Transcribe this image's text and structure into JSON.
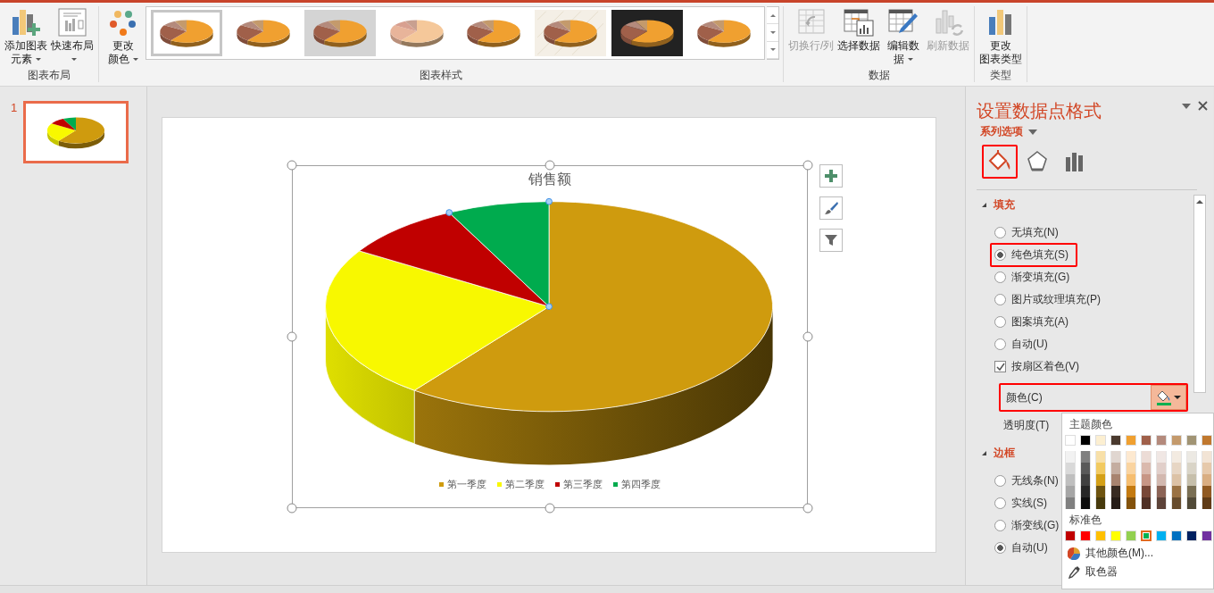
{
  "ribbon": {
    "groups": [
      {
        "label": "图表布局",
        "buttons": [
          {
            "kind": "add-element",
            "lines": [
              "添加图表",
              "元素"
            ],
            "dropdown": true,
            "disabled": false
          },
          {
            "kind": "layout",
            "lines": [
              "快速布局"
            ],
            "dropdown": true,
            "disabled": false
          }
        ]
      },
      {
        "label": "图表样式",
        "buttons": [
          {
            "kind": "colors",
            "lines": [
              "更改",
              "颜色"
            ],
            "dropdown": true,
            "disabled": false
          }
        ],
        "gallery": [
          {
            "selected": true
          },
          {
            "selected": false
          },
          {
            "selected": false
          },
          {
            "selected": false
          },
          {
            "selected": false
          },
          {
            "selected": false
          },
          {
            "selected": false
          },
          {
            "selected": false
          }
        ]
      },
      {
        "label": "数据",
        "buttons": [
          {
            "kind": "switch",
            "lines": [
              "切换行/列"
            ],
            "dropdown": false,
            "disabled": true
          },
          {
            "kind": "select-data",
            "lines": [
              "选择数据"
            ],
            "dropdown": false,
            "disabled": false
          },
          {
            "kind": "edit-data",
            "lines": [
              "编辑数",
              "据"
            ],
            "dropdown": true,
            "disabled": false
          },
          {
            "kind": "refresh",
            "lines": [
              "刷新数据"
            ],
            "dropdown": false,
            "disabled": true
          }
        ]
      },
      {
        "label": "类型",
        "buttons": [
          {
            "kind": "change-type",
            "lines": [
              "更改",
              "图表类型"
            ],
            "dropdown": false,
            "disabled": false
          }
        ]
      }
    ]
  },
  "slides": [
    {
      "number": "1",
      "selected": true
    }
  ],
  "chart": {
    "title": "销售额",
    "legend": [
      {
        "label": "第一季度",
        "color": "#cf9b0e"
      },
      {
        "label": "第二季度",
        "color": "#f8f800"
      },
      {
        "label": "第三季度",
        "color": "#c00000"
      },
      {
        "label": "第四季度",
        "color": "#00ab4e"
      }
    ]
  },
  "format_pane": {
    "title": "设置数据点格式",
    "options_menu": "系列选项",
    "tabs": [
      {
        "kind": "fill",
        "selected": true,
        "highlighted": true
      },
      {
        "kind": "effects",
        "selected": false,
        "highlighted": false
      },
      {
        "kind": "options",
        "selected": false,
        "highlighted": false
      }
    ],
    "sections": [
      {
        "heading": "填充",
        "expanded": true,
        "items": [
          {
            "kind": "radio",
            "label": "无填充(N)",
            "selected": false,
            "highlighted": false
          },
          {
            "kind": "radio",
            "label": "纯色填充(S)",
            "selected": true,
            "highlighted": true
          },
          {
            "kind": "radio",
            "label": "渐变填充(G)",
            "selected": false,
            "highlighted": false
          },
          {
            "kind": "radio",
            "label": "图片或纹理填充(P)",
            "selected": false,
            "highlighted": false
          },
          {
            "kind": "radio",
            "label": "图案填充(A)",
            "selected": false,
            "highlighted": false
          },
          {
            "kind": "radio",
            "label": "自动(U)",
            "selected": false,
            "highlighted": false
          },
          {
            "kind": "checkbox",
            "label": "按扇区着色(V)",
            "checked": true
          },
          {
            "kind": "color",
            "label": "颜色(C)",
            "color": "#00b050",
            "open": true,
            "highlighted": true
          },
          {
            "kind": "text",
            "label": "透明度(T)"
          }
        ]
      },
      {
        "heading": "边框",
        "expanded": true,
        "items": [
          {
            "kind": "radio",
            "label": "无线条(N)",
            "selected": false,
            "highlighted": false
          },
          {
            "kind": "radio",
            "label": "实线(S)",
            "selected": false,
            "highlighted": false
          },
          {
            "kind": "radio",
            "label": "渐变线(G)",
            "selected": false,
            "highlighted": false
          },
          {
            "kind": "radio",
            "label": "自动(U)",
            "selected": true,
            "highlighted": false
          }
        ]
      }
    ]
  },
  "color_picker": {
    "theme_label": "主题颜色",
    "theme_colors": [
      {
        "color": "#ffffff",
        "selected": false,
        "tints": [
          {
            "color": "#f2f2f2"
          },
          {
            "color": "#d9d9d9"
          },
          {
            "color": "#bfbfbf"
          },
          {
            "color": "#a6a6a6"
          },
          {
            "color": "#808080"
          }
        ]
      },
      {
        "color": "#000000",
        "selected": false,
        "tints": [
          {
            "color": "#7f7f7f"
          },
          {
            "color": "#595959"
          },
          {
            "color": "#404040"
          },
          {
            "color": "#262626"
          },
          {
            "color": "#0d0d0d"
          }
        ]
      },
      {
        "color": "#fcefd1",
        "selected": false,
        "tints": [
          {
            "color": "#f8e0a8"
          },
          {
            "color": "#f2ca60"
          },
          {
            "color": "#d4a017"
          },
          {
            "color": "#6e5410"
          },
          {
            "color": "#473a0c"
          }
        ]
      },
      {
        "color": "#4a3a2e",
        "selected": false,
        "tints": [
          {
            "color": "#e0d6d0"
          },
          {
            "color": "#c4ada0"
          },
          {
            "color": "#a88470"
          },
          {
            "color": "#382b22"
          },
          {
            "color": "#251c17"
          }
        ]
      },
      {
        "color": "#f0a030",
        "selected": false,
        "tints": [
          {
            "color": "#fde9d0"
          },
          {
            "color": "#fad4a0"
          },
          {
            "color": "#f6be70"
          },
          {
            "color": "#c47a10"
          },
          {
            "color": "#83520b"
          }
        ]
      },
      {
        "color": "#a0604a",
        "selected": false,
        "tints": [
          {
            "color": "#ecdcd6"
          },
          {
            "color": "#dab9ad"
          },
          {
            "color": "#c79685"
          },
          {
            "color": "#784837"
          },
          {
            "color": "#503025"
          }
        ]
      },
      {
        "color": "#b48a7c",
        "selected": false,
        "tints": [
          {
            "color": "#f0e7e4"
          },
          {
            "color": "#e1cfca"
          },
          {
            "color": "#d2b8af"
          },
          {
            "color": "#8c6456"
          },
          {
            "color": "#5d4339"
          }
        ]
      },
      {
        "color": "#c49a6c",
        "selected": false,
        "tints": [
          {
            "color": "#f3ebe1"
          },
          {
            "color": "#e7d6c4"
          },
          {
            "color": "#dcc2a6"
          },
          {
            "color": "#9a7244"
          },
          {
            "color": "#674c2d"
          }
        ]
      },
      {
        "color": "#a19474",
        "selected": false,
        "tints": [
          {
            "color": "#ece9e3"
          },
          {
            "color": "#d9d4c7"
          },
          {
            "color": "#c6bfab"
          },
          {
            "color": "#7a6f54"
          },
          {
            "color": "#514a38"
          }
        ]
      },
      {
        "color": "#c0782e",
        "selected": false,
        "tints": [
          {
            "color": "#f2e4d5"
          },
          {
            "color": "#e6c9ab"
          },
          {
            "color": "#d9ae82"
          },
          {
            "color": "#905a22"
          },
          {
            "color": "#603c17"
          }
        ]
      }
    ],
    "standard_label": "标准色",
    "standard_colors": [
      {
        "color": "#c00000",
        "selected": false
      },
      {
        "color": "#ff0000",
        "selected": false
      },
      {
        "color": "#ffc000",
        "selected": false
      },
      {
        "color": "#ffff00",
        "selected": false
      },
      {
        "color": "#92d050",
        "selected": false
      },
      {
        "color": "#00b050",
        "selected": true
      },
      {
        "color": "#00b0f0",
        "selected": false
      },
      {
        "color": "#0070c0",
        "selected": false
      },
      {
        "color": "#002060",
        "selected": false
      },
      {
        "color": "#7030a0",
        "selected": false
      }
    ],
    "more_colors": "其他颜色(M)...",
    "eyedropper": "取色器"
  }
}
